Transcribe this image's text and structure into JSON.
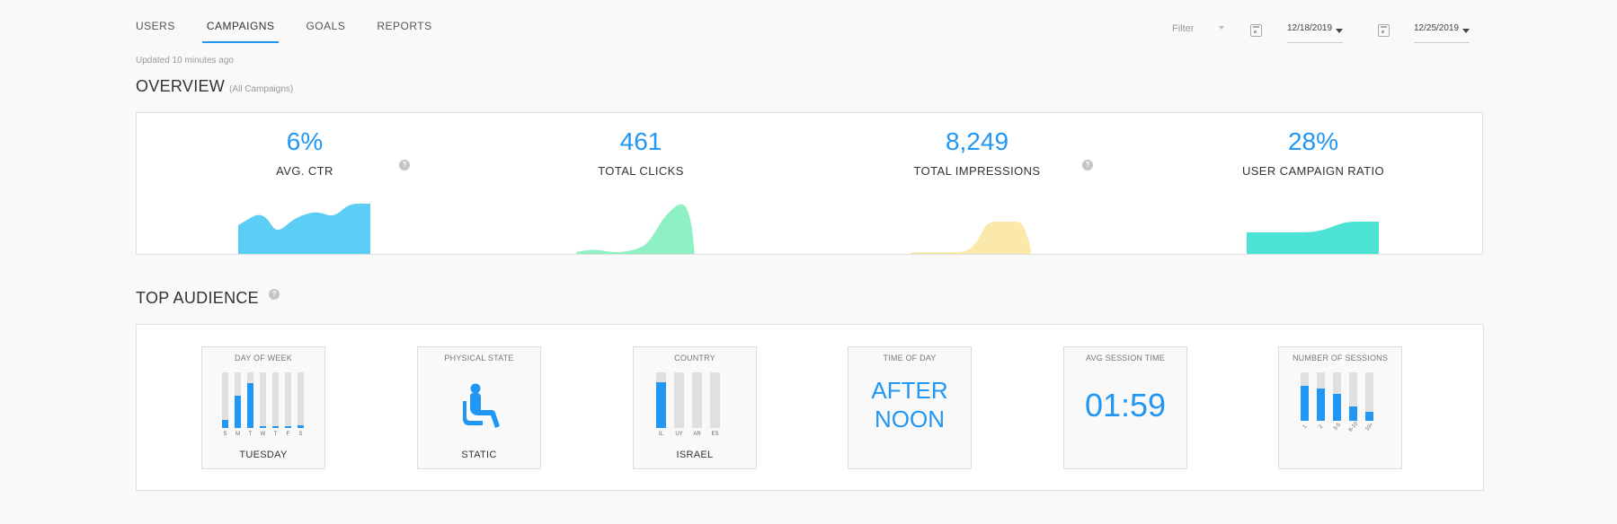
{
  "nav": {
    "tabs": [
      {
        "label": "USERS"
      },
      {
        "label": "CAMPAIGNS",
        "active": true
      },
      {
        "label": "GOALS"
      },
      {
        "label": "REPORTS"
      }
    ]
  },
  "filter": {
    "placeholder": "Filter",
    "start_date": "12/18/2019",
    "end_date": "12/25/2019"
  },
  "updated": "Updated 10 minutes ago",
  "overview": {
    "title": "OVERVIEW",
    "subtitle": "(All Campaigns)",
    "metrics": [
      {
        "value": "6%",
        "label": "AVG. CTR",
        "color": "#5ccdf5"
      },
      {
        "value": "461",
        "label": "TOTAL CLICKS",
        "color": "#8ef0c4"
      },
      {
        "value": "8,249",
        "label": "TOTAL IMPRESSIONS",
        "color": "#fbe9ac"
      },
      {
        "value": "28%",
        "label": "USER CAMPAIGN RATIO",
        "color": "#4de3d4"
      }
    ]
  },
  "audience": {
    "title": "TOP AUDIENCE",
    "cards": [
      {
        "title": "DAY OF WEEK",
        "caption": "TUESDAY",
        "bars": [
          {
            "tick": "S",
            "level": 0.15
          },
          {
            "tick": "M",
            "level": 0.58
          },
          {
            "tick": "T",
            "level": 0.8
          },
          {
            "tick": "W",
            "level": 0.03
          },
          {
            "tick": "T",
            "level": 0.03
          },
          {
            "tick": "F",
            "level": 0.03
          },
          {
            "tick": "S",
            "level": 0.05
          }
        ]
      },
      {
        "title": "PHYSICAL STATE",
        "caption": "STATIC",
        "icon": "seated-person-icon"
      },
      {
        "title": "COUNTRY",
        "caption": "ISRAEL",
        "bars": [
          {
            "tick": "IL",
            "level": 0.82
          },
          {
            "tick": "UY",
            "level": 0
          },
          {
            "tick": "AR",
            "level": 0
          },
          {
            "tick": "ES",
            "level": 0
          }
        ]
      },
      {
        "title": "TIME OF DAY",
        "big_lines": [
          "AFTER",
          "NOON"
        ]
      },
      {
        "title": "AVG SESSION TIME",
        "big_lines": [
          "01:59"
        ]
      },
      {
        "title": "NUMBER OF SESSIONS",
        "bars": [
          {
            "tick": "1",
            "level": 0.72
          },
          {
            "tick": "2",
            "level": 0.66
          },
          {
            "tick": "3-5",
            "level": 0.55
          },
          {
            "tick": "6-10",
            "level": 0.3
          },
          {
            "tick": "10+",
            "level": 0.18
          }
        ]
      }
    ]
  }
}
